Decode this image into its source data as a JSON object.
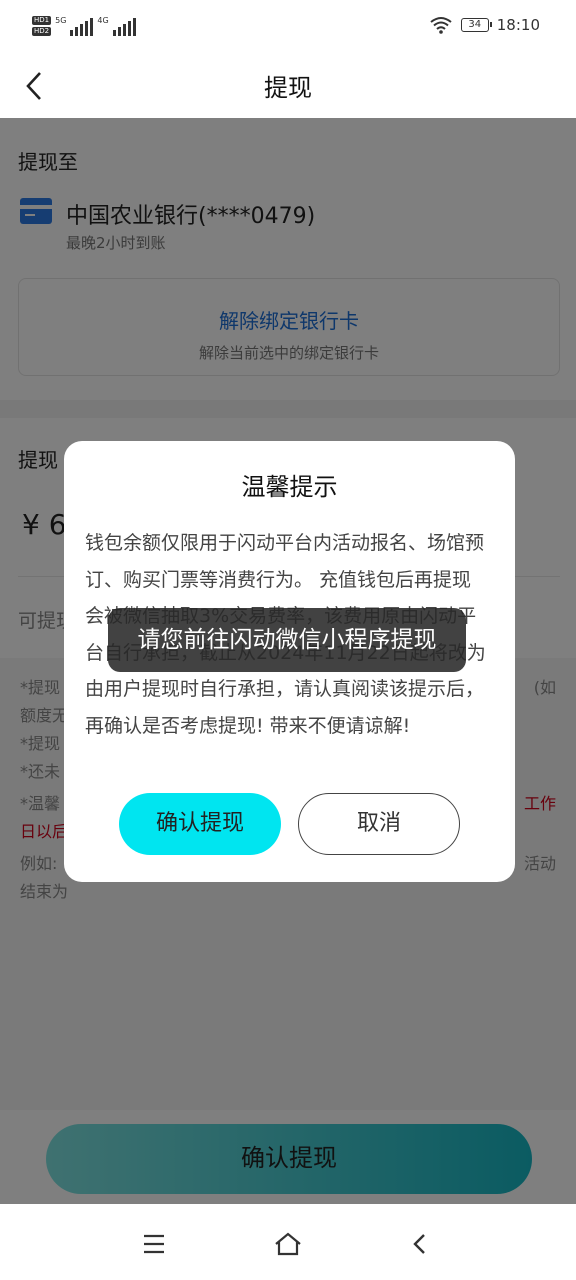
{
  "status_bar": {
    "hd1": "HD1",
    "hd2": "HD2",
    "net1": "5G",
    "net2": "4G",
    "battery": "34",
    "time": "18:10"
  },
  "header": {
    "title": "提现",
    "back_icon": "back-chevron-icon"
  },
  "withdraw_to": {
    "section_title": "提现至",
    "bank_icon": "bank-card-icon",
    "bank_name": "中国农业银行(****0479)",
    "arrival_note": "最晚2小时到账",
    "unbind_title": "解除绑定银行卡",
    "unbind_subtitle": "解除当前选中的绑定银行卡"
  },
  "amount_section": {
    "title_partial": "提现",
    "amount_partial": "¥ 6",
    "available_partial": "可提现"
  },
  "notes": {
    "line1_left": "*提现",
    "line1_right": "(如",
    "line2": "额度无",
    "line3": "*提现",
    "line4": "*还未",
    "line5_left": "*温馨",
    "line5_right": "工作",
    "line6": "日以后",
    "line7_left": "例如:",
    "line7_right": "活动",
    "line8": "结束为"
  },
  "footer": {
    "confirm_label": "确认提现"
  },
  "nav_bar": {
    "menu_icon": "menu-icon",
    "home_icon": "home-icon",
    "back_icon": "back-icon"
  },
  "dialog": {
    "title": "温馨提示",
    "body": "钱包余额仅限用于闪动平台内活动报名、场馆预订、购买门票等消费行为。 充值钱包后再提现会被微信抽取3%交易费率，该费用原由闪动平台自行承担，截止从2024年11月22日起将改为由用户提现时自行承担，请认真阅读该提示后，再确认是否考虑提现! 带来不便请谅解!",
    "confirm_label": "确认提现",
    "cancel_label": "取消"
  },
  "toast": {
    "message": "请您前往闪动微信小程序提现"
  },
  "colors": {
    "accent": "#00e5f0",
    "link_blue": "#1d6fd6",
    "warning_red": "#d0021b"
  }
}
